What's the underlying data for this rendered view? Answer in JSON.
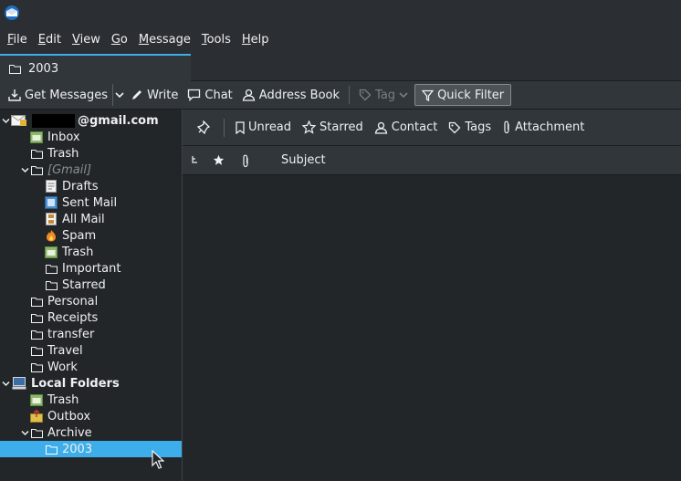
{
  "menubar": {
    "items": [
      {
        "key": "F",
        "rest": "ile"
      },
      {
        "key": "E",
        "rest": "dit"
      },
      {
        "key": "V",
        "rest": "iew"
      },
      {
        "key": "G",
        "rest": "o"
      },
      {
        "key": "M",
        "rest": "essage"
      },
      {
        "key": "T",
        "rest": "ools"
      },
      {
        "key": "H",
        "rest": "elp"
      }
    ]
  },
  "tab": {
    "label": "2003",
    "icon": "folder-icon"
  },
  "toolbar": {
    "get_messages": "Get Messages",
    "write": "Write",
    "chat": "Chat",
    "address_book": "Address Book",
    "tag": "Tag",
    "quick_filter": "Quick Filter"
  },
  "folders": {
    "account_suffix": "@gmail.com",
    "inbox": "Inbox",
    "trash": "Trash",
    "gmail": "[Gmail]",
    "drafts": "Drafts",
    "sent_mail": "Sent Mail",
    "all_mail": "All Mail",
    "spam": "Spam",
    "gmail_trash": "Trash",
    "important": "Important",
    "starred": "Starred",
    "personal": "Personal",
    "receipts": "Receipts",
    "transfer": "transfer",
    "travel": "Travel",
    "work": "Work",
    "local_folders": "Local Folders",
    "local_trash": "Trash",
    "outbox": "Outbox",
    "archive": "Archive",
    "archive_2003": "2003"
  },
  "quick_filter_bar": {
    "unread": "Unread",
    "starred": "Starred",
    "contact": "Contact",
    "tags": "Tags",
    "attachment": "Attachment"
  },
  "columns": {
    "subject": "Subject"
  },
  "colors": {
    "accent": "#3daee9",
    "background": "#232629",
    "panel": "#31363b"
  }
}
